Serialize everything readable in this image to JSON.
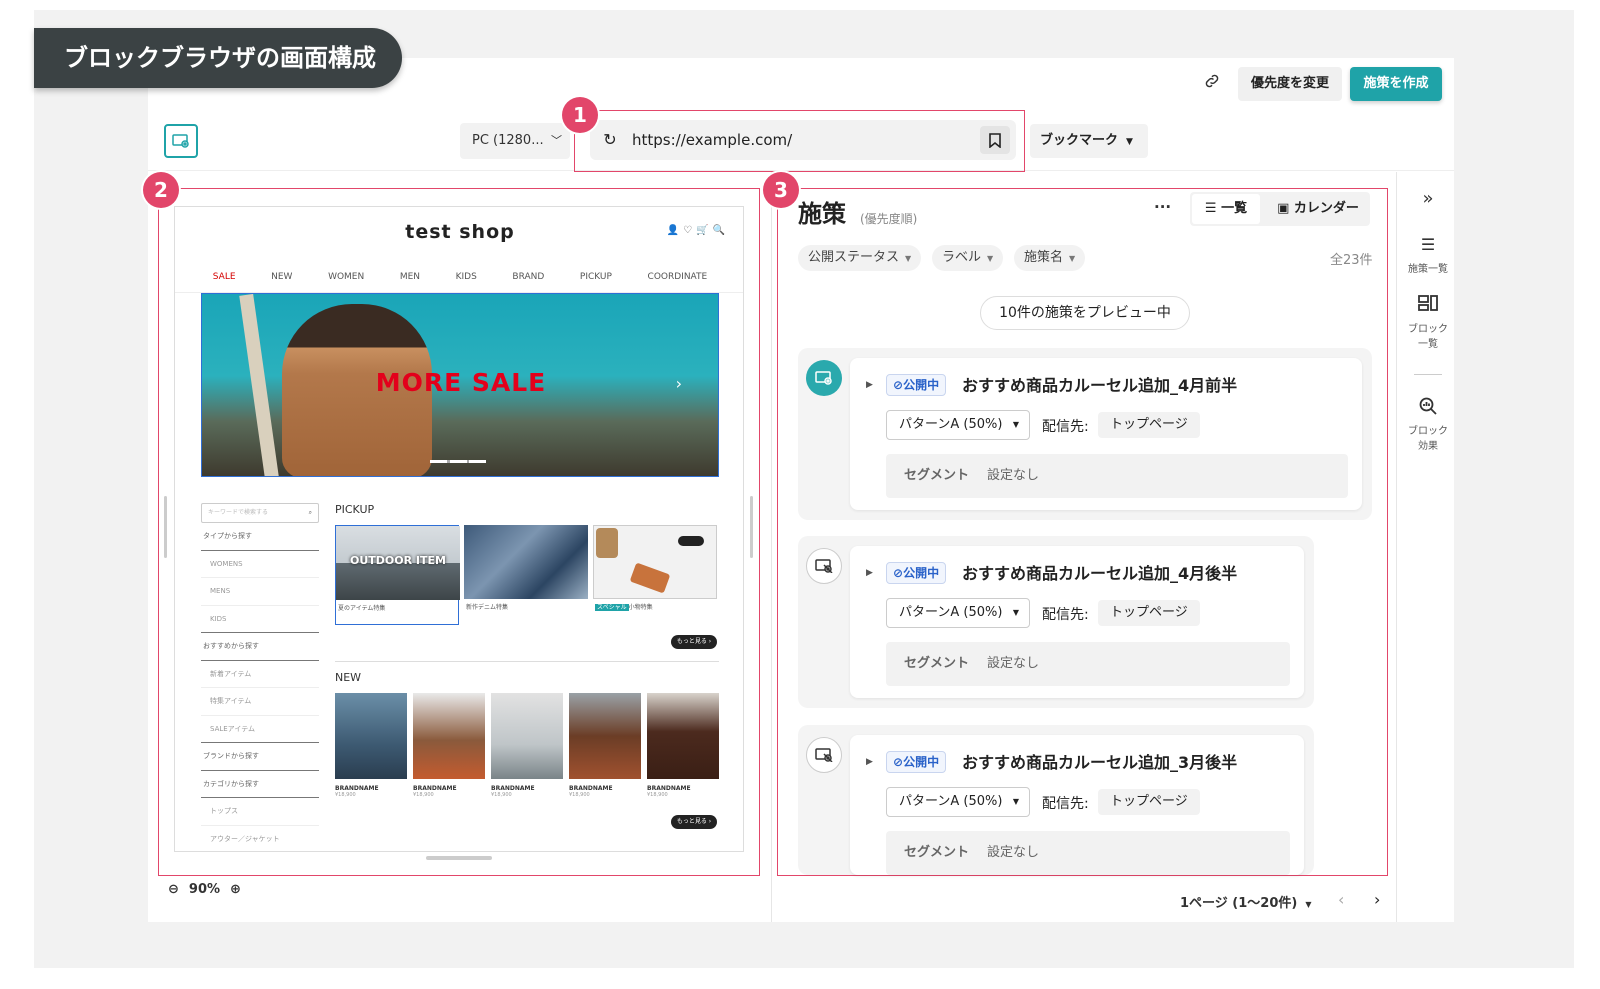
{
  "banner": {
    "title": "ブロックブラウザの画面構成"
  },
  "toolbar": {
    "priority_button": "優先度を変更",
    "create_button": "施策を作成",
    "device": "PC (1280...",
    "url": "https://example.com/",
    "bookmark": "ブックマーク"
  },
  "markers": [
    "1",
    "2",
    "3"
  ],
  "site": {
    "title": "test shop",
    "nav": [
      "SALE",
      "NEW",
      "WOMEN",
      "MEN",
      "KIDS",
      "BRAND",
      "PICKUP",
      "COORDINATE"
    ],
    "hero_text": "MORE SALE",
    "search_placeholder": "キーワードで検索する",
    "side_menu": [
      {
        "label": "タイプから探す",
        "type": "head"
      },
      {
        "label": "WOMENS",
        "type": "sub"
      },
      {
        "label": "MENS",
        "type": "sub"
      },
      {
        "label": "KIDS",
        "type": "sub"
      },
      {
        "label": "おすすめから探す",
        "type": "head"
      },
      {
        "label": "新着アイテム",
        "type": "sub"
      },
      {
        "label": "特集アイテム",
        "type": "sub"
      },
      {
        "label": "SALEアイテム",
        "type": "sub"
      },
      {
        "label": "ブランドから探す",
        "type": "head"
      },
      {
        "label": "カテゴリから探す",
        "type": "head"
      },
      {
        "label": "トップス",
        "type": "sub"
      },
      {
        "label": "アウター／ジャケット",
        "type": "sub"
      }
    ],
    "pickup_label": "PICKUP",
    "pickup_items": [
      {
        "overlay": "OUTDOOR ITEM",
        "caption": "夏のアイテム特集"
      },
      {
        "overlay": "",
        "caption": "新作デニム特集"
      },
      {
        "overlay": "",
        "tag": "スペシャル",
        "caption": "小物特集"
      }
    ],
    "more_label": "もっと見る ›",
    "new_label": "NEW",
    "new_items": [
      {
        "brand": "BRANDNAME",
        "price": "¥18,900"
      },
      {
        "brand": "BRANDNAME",
        "price": "¥18,900"
      },
      {
        "brand": "BRANDNAME",
        "price": "¥18,900"
      },
      {
        "brand": "BRANDNAME",
        "price": "¥18,900"
      },
      {
        "brand": "BRANDNAME",
        "price": "¥18,900"
      }
    ]
  },
  "zoom": {
    "level": "90%"
  },
  "panel": {
    "title": "施策",
    "subtitle": "(優先度順)",
    "more": "···",
    "view_list": "一覧",
    "view_calendar": "カレンダー",
    "filters": [
      "公開ステータス",
      "ラベル",
      "施策名"
    ],
    "total": "全23件",
    "preview_pill": "10件の施策をプレビュー中",
    "campaigns": [
      {
        "status": "公開中",
        "name": "おすすめ商品カルーセル追加_4月前半",
        "pattern": "パターンA (50%)",
        "dist_label": "配信先:",
        "dist_value": "トップページ",
        "seg_label": "セグメント",
        "seg_value": "設定なし",
        "preview": true
      },
      {
        "status": "公開中",
        "name": "おすすめ商品カルーセル追加_4月後半",
        "pattern": "パターンA (50%)",
        "dist_label": "配信先:",
        "dist_value": "トップページ",
        "seg_label": "セグメント",
        "seg_value": "設定なし",
        "preview": false
      },
      {
        "status": "公開中",
        "name": "おすすめ商品カルーセル追加_3月後半",
        "pattern": "パターンA (50%)",
        "dist_label": "配信先:",
        "dist_value": "トップページ",
        "seg_label": "セグメント",
        "seg_value": "設定なし",
        "preview": false
      }
    ],
    "pager": "1ページ (1～20件)"
  },
  "rail": {
    "items": [
      "施策一覧",
      "ブロック\n一覧",
      "ブロック\n効果"
    ]
  },
  "colors": {
    "accent": "#1fa3a8",
    "marker": "#e2466a",
    "badge_text": "#2a62c9",
    "sale_red": "#e3001b"
  }
}
